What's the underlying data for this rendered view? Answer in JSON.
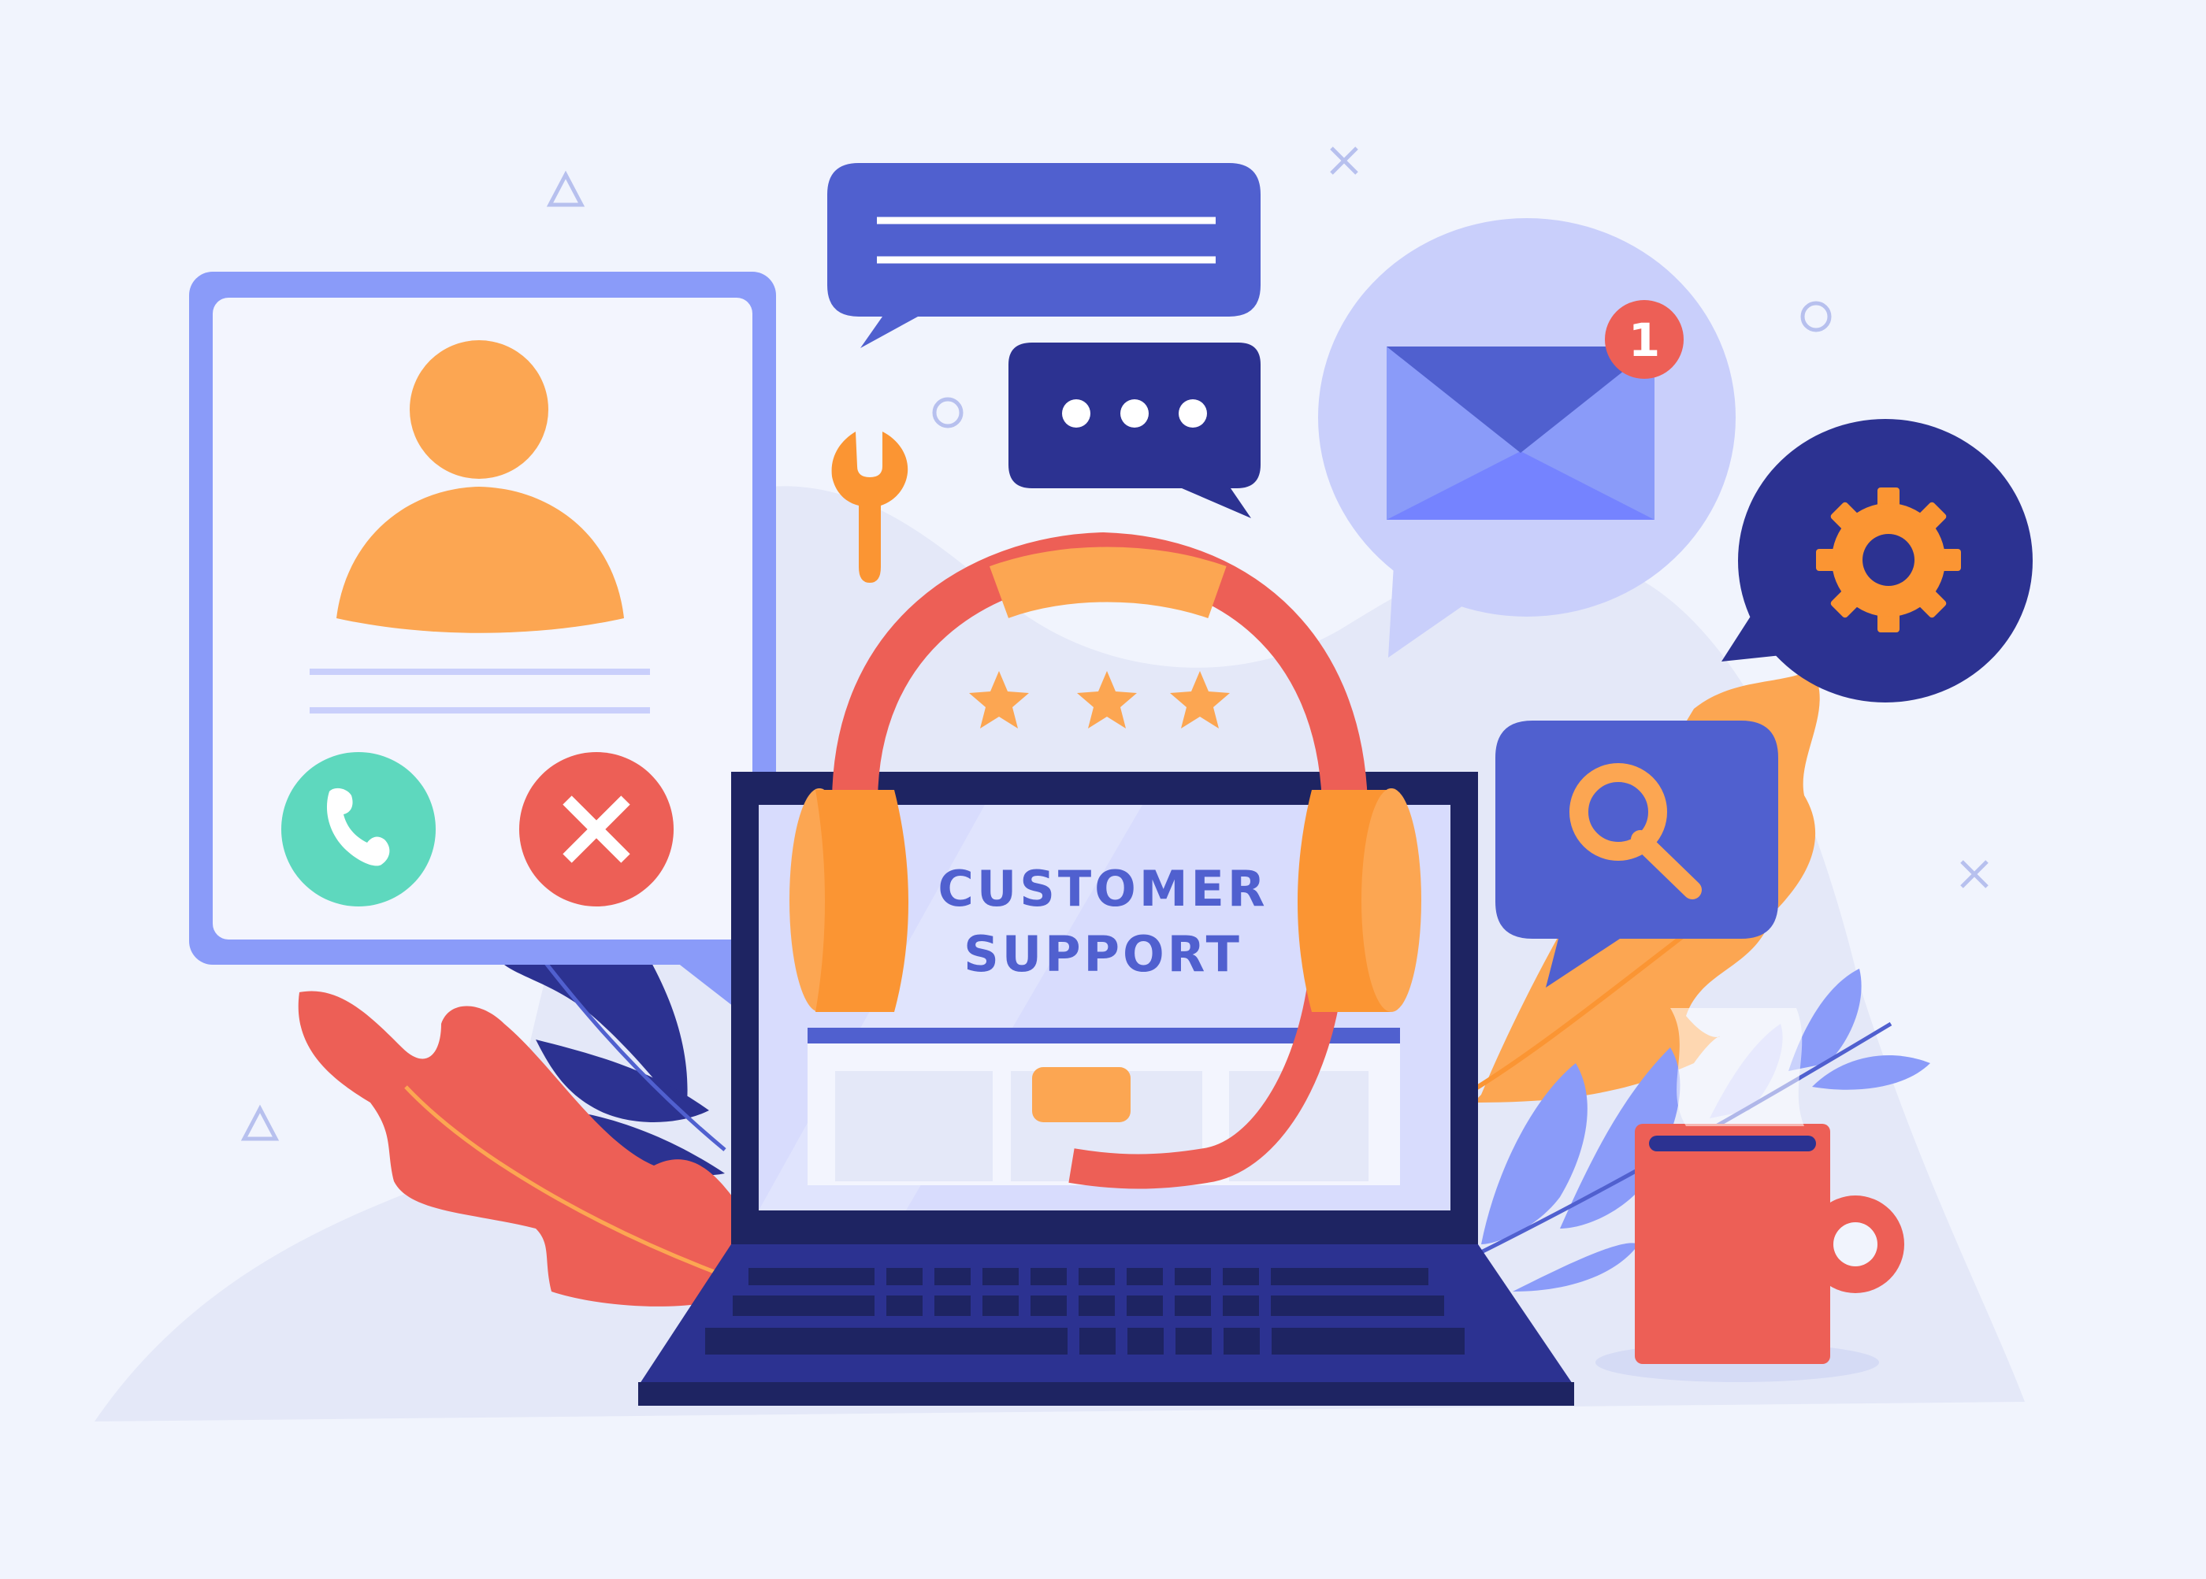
{
  "illustration": {
    "screen_text": {
      "line1": "CUSTOMER",
      "line2": "SUPPORT"
    },
    "email_notification_count": "1",
    "rating_stars": 3,
    "call_card": {
      "accept_icon": "phone-icon",
      "decline_icon": "close-icon"
    },
    "chat_bubbles": [
      {
        "kind": "text-lines",
        "lines": 2
      },
      {
        "kind": "typing-dots",
        "dots": 3
      }
    ],
    "icons": [
      "wrench-icon",
      "gear-icon",
      "magnifier-icon",
      "mail-icon",
      "headset-icon",
      "mug-icon"
    ],
    "colors": {
      "background": "#f1f4fd",
      "orange": "#fca652",
      "orange_dark": "#fb9533",
      "coral": "#ed5f56",
      "navy": "#2c3291",
      "indigo": "#5060cf",
      "periwinkle": "#8a9bf9",
      "lavender": "#c9cffb",
      "green": "#5ed8be",
      "laptop_dark": "#1e2462"
    }
  }
}
